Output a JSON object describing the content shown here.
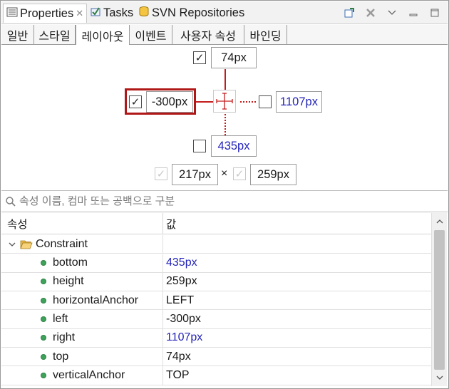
{
  "view_tabs": [
    {
      "label": "Properties",
      "icon": "properties-icon",
      "active": true
    },
    {
      "label": "Tasks",
      "icon": "tasks-icon"
    },
    {
      "label": "SVN Repositories",
      "icon": "svn-repositories-icon"
    }
  ],
  "view_toolbar": [
    "new-window-icon",
    "remove-icon",
    "view-menu-icon",
    "minimize-icon",
    "maximize-icon"
  ],
  "sub_tabs": [
    "일반",
    "스타일",
    "레이아웃",
    "이벤트",
    "사용자 속성",
    "바인딩"
  ],
  "active_sub_tab": "레이아웃",
  "layout": {
    "top": {
      "checked": true,
      "value": "74px"
    },
    "left": {
      "checked": true,
      "value": "-300px"
    },
    "right": {
      "checked": false,
      "value": "1107px"
    },
    "bottom": {
      "checked": false,
      "value": "435px"
    },
    "width": {
      "checked": true,
      "value": "217px"
    },
    "height": {
      "checked": true,
      "value": "259px"
    },
    "times": "×"
  },
  "search": {
    "placeholder": "속성 이름, 컴마 또는 공백으로 구분"
  },
  "table": {
    "headers": [
      "속성",
      "값"
    ],
    "group": "Constraint",
    "rows": [
      {
        "name": "bottom",
        "value": "435px",
        "blue": true
      },
      {
        "name": "height",
        "value": "259px",
        "blue": false
      },
      {
        "name": "horizontalAnchor",
        "value": "LEFT",
        "blue": false
      },
      {
        "name": "left",
        "value": "-300px",
        "blue": false
      },
      {
        "name": "right",
        "value": "1107px",
        "blue": true
      },
      {
        "name": "top",
        "value": "74px",
        "blue": false
      },
      {
        "name": "verticalAnchor",
        "value": "TOP",
        "blue": false
      }
    ]
  },
  "colors": {
    "accent_red": "#b01818",
    "link_blue": "#2323b8",
    "status_green": "#3ea35a"
  }
}
